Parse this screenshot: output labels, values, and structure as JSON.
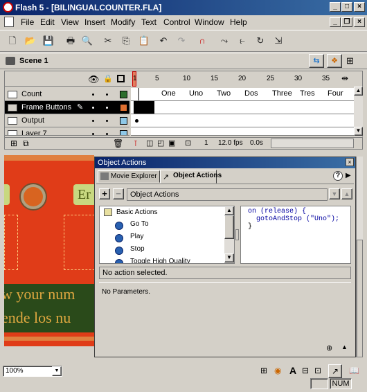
{
  "window": {
    "title": "Flash 5 - [BILINGUALCOUNTER.FLA]"
  },
  "menu": [
    "File",
    "Edit",
    "View",
    "Insert",
    "Modify",
    "Text",
    "Control",
    "Window",
    "Help"
  ],
  "scene": {
    "label": "Scene 1"
  },
  "timeline": {
    "ruler": [
      "1",
      "5",
      "10",
      "15",
      "20",
      "25",
      "30",
      "35"
    ],
    "layers": [
      {
        "name": "Count",
        "color": "#2c6d2c",
        "selected": false
      },
      {
        "name": "Frame Buttons",
        "color": "#e07030",
        "selected": true
      },
      {
        "name": "Output",
        "color": "#8ec8e8",
        "selected": false
      },
      {
        "name": "Layer 7",
        "color": "#8ec8e8",
        "selected": false
      }
    ],
    "frame_labels": [
      "One",
      "Uno",
      "Two",
      "Dos",
      "Three",
      "Tres",
      "Four"
    ],
    "current_frame": "1",
    "fps": "12.0 fps",
    "time": "0.0s"
  },
  "stage": {
    "text_line1": "w your num",
    "text_line2": "ende los nu",
    "btn_partial": "Er"
  },
  "panel": {
    "title": "Object Actions",
    "tabs": [
      "Movie Explorer",
      "Object Actions"
    ],
    "header": "Object Actions",
    "tree": {
      "folder": "Basic Actions",
      "items": [
        "Go To",
        "Play",
        "Stop",
        "Toggle High Quality"
      ]
    },
    "code": [
      "on (release) {",
      "  gotoAndStop (\"Uno\");",
      "}"
    ],
    "status": "No action selected.",
    "params": "No Parameters."
  },
  "bottom": {
    "zoom": "100%",
    "indicator": "NUM"
  }
}
